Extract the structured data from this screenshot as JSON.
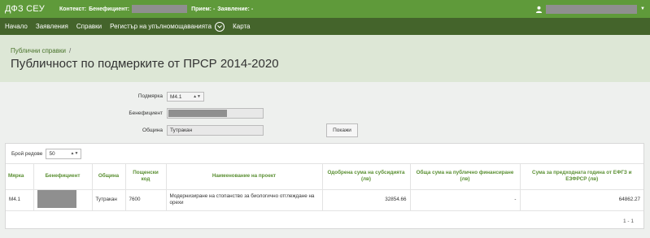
{
  "topbar": {
    "brand": "ДФЗ СЕУ",
    "context_label": "Контекст:",
    "beneficiary_label": "Бенефициент:",
    "intake_label": "Прием: -",
    "application_label": "Заявление: -"
  },
  "nav": {
    "items": [
      "Начало",
      "Заявления",
      "Справки",
      "Регистър на упълномощаванията",
      "Карта"
    ]
  },
  "header": {
    "breadcrumb": "Публични справки",
    "breadcrumb_sep": "/",
    "title": "Публичност по подмерките от ПРСР 2014-2020"
  },
  "form": {
    "submeasure_label": "Подмярка",
    "submeasure_value": "М4.1",
    "beneficiary_label": "Бенефициент",
    "municipality_label": "Община",
    "municipality_value": "Тутракан",
    "show_button": "Покажи"
  },
  "table": {
    "rows_label": "Брой редове",
    "rows_value": "50",
    "headers": [
      "Мярка",
      "Бенефициент",
      "Община",
      "Пощенски код",
      "Наименование на проект",
      "Одобрена сума на субсидията (лв)",
      "Обща сума на публично финансиране (лв)",
      "Сума за предходната година от ЕФГЗ и ЕЗФРСР (лв)"
    ],
    "rows": [
      {
        "measure": "М4.1",
        "municipality": "Тутракан",
        "postal_code": "7600",
        "project": "Модернизиране на стопанство за биологично отглеждане на орехи",
        "approved": "32854.66",
        "total_public": "-",
        "previous_year": "64862.27"
      }
    ],
    "pager": "1 - 1"
  }
}
